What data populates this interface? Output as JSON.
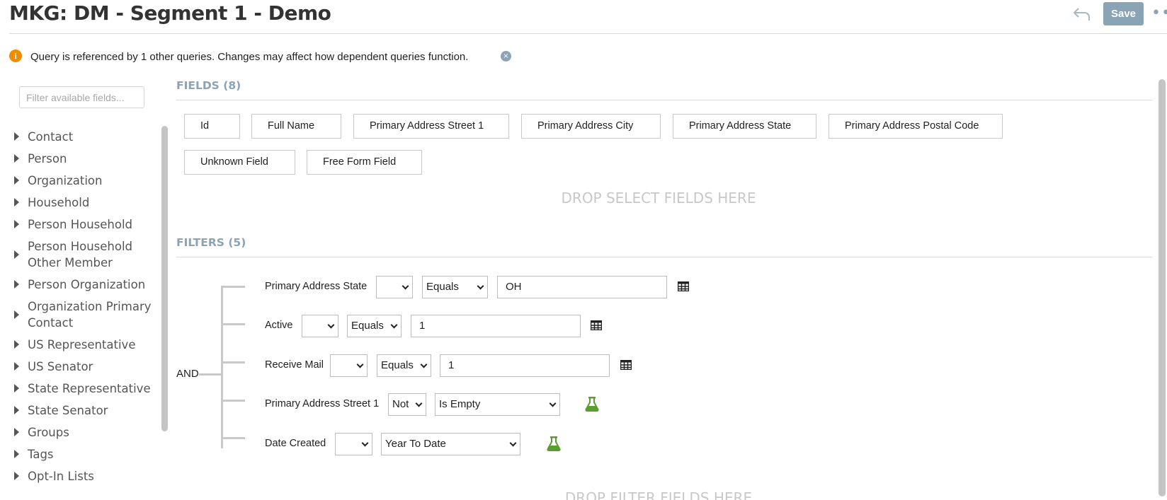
{
  "header": {
    "title": "MKG: DM - Segment 1 - Demo",
    "save_label": "Save",
    "more_label": "•••"
  },
  "alert": {
    "icon": "info-icon",
    "icon_glyph": "i",
    "text": "Query is referenced by 1 other queries. Changes may affect how dependent queries function.",
    "close_glyph": "×"
  },
  "sidebar": {
    "filter_placeholder": "Filter available fields...",
    "items": [
      {
        "label": "Contact"
      },
      {
        "label": "Person"
      },
      {
        "label": "Organization"
      },
      {
        "label": "Household"
      },
      {
        "label": "Person Household"
      },
      {
        "label": "Person Household Other Member"
      },
      {
        "label": "Person Organization"
      },
      {
        "label": "Organization Primary Contact"
      },
      {
        "label": "US Representative"
      },
      {
        "label": "US Senator"
      },
      {
        "label": "State Representative"
      },
      {
        "label": "State Senator"
      },
      {
        "label": "Groups"
      },
      {
        "label": "Tags"
      },
      {
        "label": "Opt-In Lists"
      }
    ]
  },
  "fields": {
    "title": "FIELDS (8)",
    "items": [
      "Id",
      "Full Name",
      "Primary Address Street 1",
      "Primary Address City",
      "Primary Address State",
      "Primary Address Postal Code",
      "Unknown Field",
      "Free Form Field"
    ],
    "drop_text": "DROP SELECT FIELDS HERE"
  },
  "filters": {
    "title": "FILTERS (5)",
    "conjunction": "AND",
    "rows": [
      {
        "field": "Primary Address State",
        "modifier": "",
        "operator": "Equals",
        "value": "OH",
        "action_icon": "table-icon"
      },
      {
        "field": "Active",
        "modifier": "",
        "operator": "Equals",
        "value": "1",
        "action_icon": "table-icon"
      },
      {
        "field": "Receive Mail",
        "modifier": "",
        "operator": "Equals",
        "value": "1",
        "action_icon": "table-icon"
      },
      {
        "field": "Primary Address Street 1",
        "modifier": "Not",
        "operator": "Is Empty",
        "value": null,
        "action_icon": "flask-icon"
      },
      {
        "field": "Date Created",
        "modifier": "",
        "operator": "Year To Date",
        "value": null,
        "action_icon": "flask-icon"
      }
    ],
    "drop_text": "DROP FILTER FIELDS HERE"
  },
  "colors": {
    "accent": "#8aa3b5",
    "warning": "#f08c00",
    "flask": "#5a9e32"
  }
}
